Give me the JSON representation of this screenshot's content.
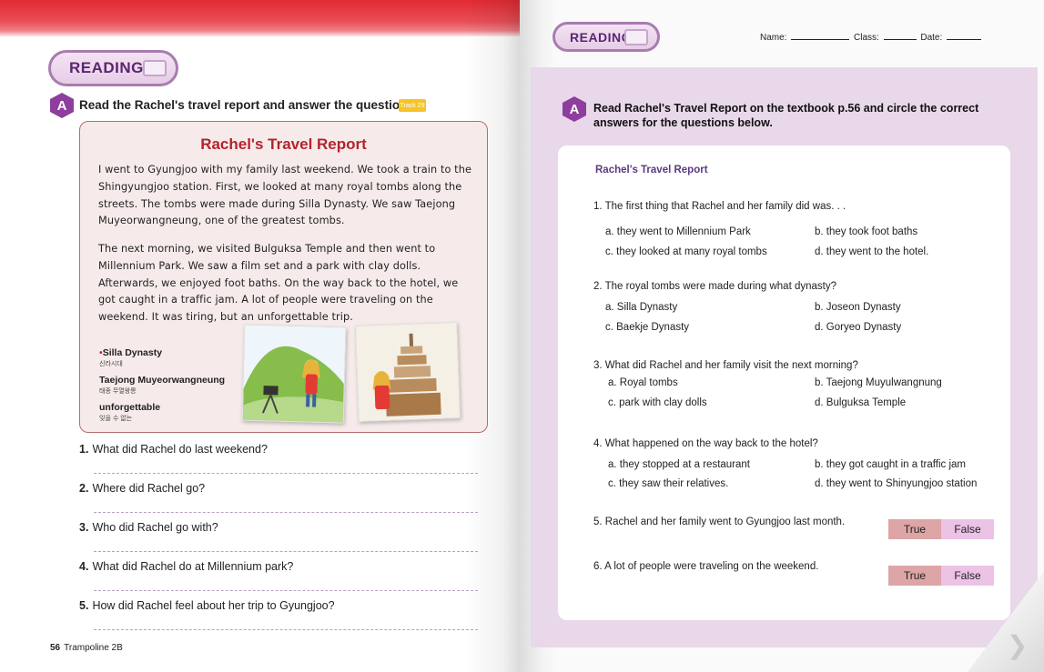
{
  "left_page": {
    "badge": "READING",
    "section_letter": "A",
    "instruction": "Read the Rachel's travel report and answer the questions.",
    "track": "Track 29",
    "report": {
      "title": "Rachel's Travel Report",
      "paragraph_1": "I went to Gyungjoo with my family last weekend. We took a train to the Shingyungjoo station. First, we looked at many royal tombs along the streets. The tombs were made during Silla Dynasty. We saw Taejong Muyeorwangneung, one of the greatest tombs.",
      "paragraph_2": "The next morning, we visited Bulguksa Temple and then went to Millennium Park. We saw a film set and a park with clay dolls. Afterwards, we enjoyed foot baths. On the way back to the hotel, we got caught in a traffic jam. A lot of people were traveling on the weekend. It was tiring, but an unforgettable trip.",
      "glossary": [
        {
          "star": "•",
          "term": "Silla Dynasty",
          "korean": "신라시대"
        },
        {
          "star": "",
          "term": "Taejong Muyeorwangneung",
          "korean": "태종 무열왕릉"
        },
        {
          "star": "",
          "term": "unforgettable",
          "korean": "잊을 수 없는"
        }
      ]
    },
    "questions": [
      {
        "num": "1.",
        "text": "What did Rachel do last weekend?"
      },
      {
        "num": "2.",
        "text": "Where did Rachel go?"
      },
      {
        "num": "3.",
        "text": "Who did Rachel go with?"
      },
      {
        "num": "4.",
        "text": "What did Rachel do at Millennium park?"
      },
      {
        "num": "5.",
        "text": "How did Rachel feel about her trip to Gyungjoo?"
      }
    ],
    "footer": {
      "page_number": "56",
      "book": "Trampoline 2B"
    }
  },
  "right_page": {
    "badge": "READING",
    "header": {
      "name_label": "Name:",
      "class_label": "Class:",
      "date_label": "Date:"
    },
    "section_letter": "A",
    "instruction": "Read Rachel's Travel Report on the textbook p.56 and circle the correct answers for the questions below.",
    "card_title": "Rachel's Travel Report",
    "questions": [
      {
        "text": "1. The first thing that Rachel and her family did was. . .",
        "options": [
          "a. they went to Millennium Park",
          "b. they took foot baths",
          "c. they looked at many royal tombs",
          "d. they went to the hotel."
        ]
      },
      {
        "text": "2. The royal tombs were made during what dynasty?",
        "options": [
          "a. Silla Dynasty",
          "b. Joseon Dynasty",
          "c. Baekje Dynasty",
          "d. Goryeo Dynasty"
        ]
      },
      {
        "text": "3. What did Rachel and her family visit the next morning?",
        "options": [
          "a. Royal tombs",
          "b. Taejong Muyulwangnung",
          "c. park with clay dolls",
          "d. Bulguksa Temple"
        ]
      },
      {
        "text": "4. What happened on the way back to the hotel?",
        "options": [
          "a. they stopped at a restaurant",
          "b. they got caught in a traffic jam",
          "c. they saw their relatives.",
          "d. they went to Shinyungjoo  station"
        ]
      }
    ],
    "true_false": [
      {
        "text": "5. Rachel and her family went to Gyungjoo last month.",
        "true_label": "True",
        "false_label": "False"
      },
      {
        "text": "6. A lot of people were traveling on the weekend.",
        "true_label": "True",
        "false_label": "False"
      }
    ]
  },
  "colors": {
    "accent_red": "#e22a33",
    "title_red": "#b4232d",
    "purple": "#8e3e9c",
    "panel_purple": "#e8d8e9",
    "true_pink": "#dda5a5",
    "false_pink": "#ecc2e6"
  }
}
